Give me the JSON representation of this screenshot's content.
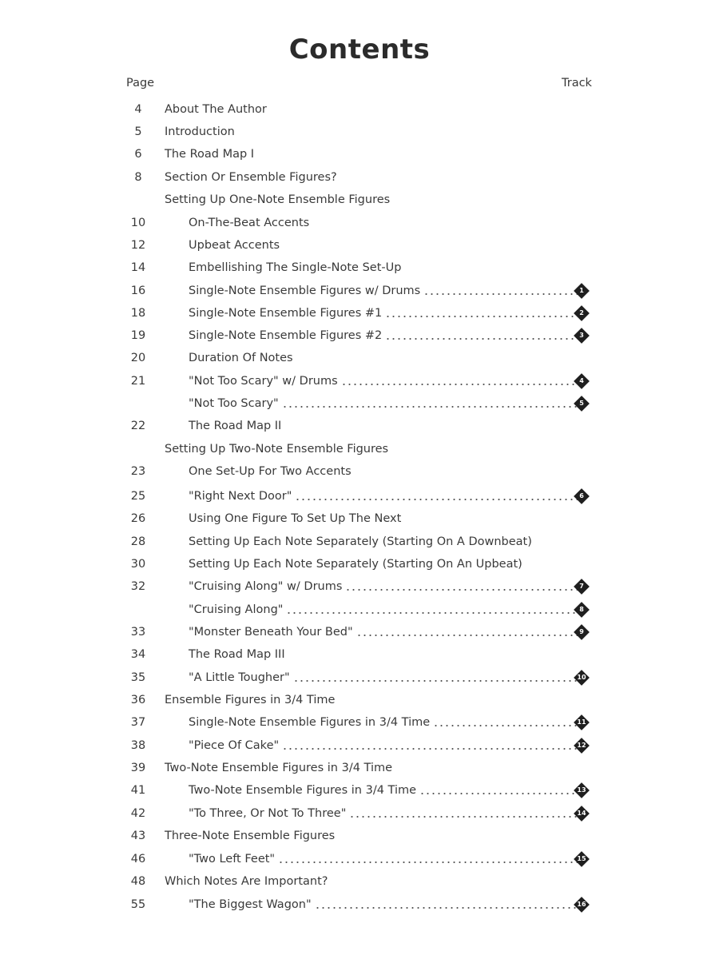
{
  "title": "Contents",
  "headers": {
    "page": "Page",
    "track": "Track"
  },
  "entries": [
    {
      "page": "4",
      "title": "About The Author",
      "level": 0,
      "track": null
    },
    {
      "page": "5",
      "title": "Introduction",
      "level": 0,
      "track": null
    },
    {
      "page": "6",
      "title": "The Road Map I",
      "level": 0,
      "track": null
    },
    {
      "page": "8",
      "title": "Section Or Ensemble Figures?",
      "level": 0,
      "track": null
    },
    {
      "page": "",
      "title": "Setting Up One-Note Ensemble Figures",
      "level": 0,
      "track": null
    },
    {
      "page": "10",
      "title": "On-The-Beat Accents",
      "level": 1,
      "track": null
    },
    {
      "page": "12",
      "title": "Upbeat Accents",
      "level": 1,
      "track": null
    },
    {
      "page": "14",
      "title": "Embellishing The Single-Note Set-Up",
      "level": 1,
      "track": null
    },
    {
      "page": "16",
      "title": "Single-Note Ensemble Figures w/ Drums",
      "level": 1,
      "track": "1"
    },
    {
      "page": "18",
      "title": "Single-Note Ensemble Figures #1",
      "level": 1,
      "track": "2"
    },
    {
      "page": "19",
      "title": "Single-Note Ensemble Figures #2",
      "level": 1,
      "track": "3"
    },
    {
      "page": "20",
      "title": "Duration Of Notes",
      "level": 1,
      "track": null
    },
    {
      "page": "21",
      "title": "\"Not Too Scary\" w/ Drums",
      "level": 1,
      "track": "4"
    },
    {
      "page": "",
      "title": "\"Not Too Scary\"",
      "level": 1,
      "track": "5"
    },
    {
      "page": "22",
      "title": "The Road Map II",
      "level": 1,
      "track": null
    },
    {
      "page": "",
      "title": "Setting Up Two-Note Ensemble Figures",
      "level": 0,
      "track": null
    },
    {
      "page": "23",
      "title": "One Set-Up For Two Accents",
      "level": 1,
      "track": null
    },
    {
      "page": "25",
      "title": "\"Right Next Door\"",
      "level": 1,
      "track": "6"
    },
    {
      "page": "26",
      "title": "Using One Figure To Set Up The Next",
      "level": 1,
      "track": null
    },
    {
      "page": "28",
      "title": "Setting Up Each Note Separately (Starting On A Downbeat)",
      "level": 1,
      "track": null
    },
    {
      "page": "30",
      "title": "Setting Up Each Note Separately (Starting On An Upbeat)",
      "level": 1,
      "track": null
    },
    {
      "page": "32",
      "title": "\"Cruising Along\" w/ Drums",
      "level": 1,
      "track": "7"
    },
    {
      "page": "",
      "title": "\"Cruising Along\"",
      "level": 1,
      "track": "8"
    },
    {
      "page": "33",
      "title": "\"Monster Beneath Your Bed\"",
      "level": 1,
      "track": "9"
    },
    {
      "page": "34",
      "title": "The Road Map III",
      "level": 1,
      "track": null
    },
    {
      "page": "35",
      "title": "\"A Little Tougher\"",
      "level": 1,
      "track": "10"
    },
    {
      "page": "36",
      "title": "Ensemble Figures in 3/4 Time",
      "level": 0,
      "track": null
    },
    {
      "page": "37",
      "title": "Single-Note Ensemble Figures in 3/4 Time",
      "level": 1,
      "track": "11"
    },
    {
      "page": "38",
      "title": "\"Piece Of Cake\"",
      "level": 1,
      "track": "12"
    },
    {
      "page": "39",
      "title": "Two-Note Ensemble Figures in 3/4 Time",
      "level": 0,
      "track": null
    },
    {
      "page": "41",
      "title": "Two-Note Ensemble Figures in 3/4 Time",
      "level": 1,
      "track": "13"
    },
    {
      "page": "42",
      "title": "\"To Three, Or Not To Three\"",
      "level": 1,
      "track": "14"
    },
    {
      "page": "43",
      "title": "Three-Note Ensemble Figures",
      "level": 0,
      "track": null
    },
    {
      "page": "46",
      "title": "\"Two Left Feet\"",
      "level": 1,
      "track": "15"
    },
    {
      "page": "48",
      "title": "Which Notes Are Important?",
      "level": 0,
      "track": null
    },
    {
      "page": "55",
      "title": "\"The Biggest Wagon\"",
      "level": 1,
      "track": "16"
    }
  ]
}
